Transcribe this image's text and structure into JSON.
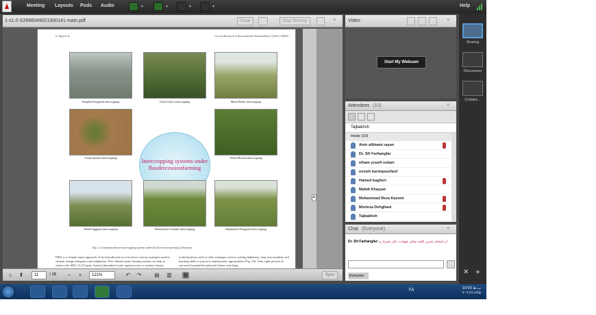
{
  "menubar": {
    "items": [
      "Meeting",
      "Layouts",
      "Pods",
      "Audio"
    ],
    "help": "Help"
  },
  "share": {
    "doc_title": "1-s1.0-S2666049021000141-main.pdf",
    "buttons": [
      "Draw",
      "Stop Sharing"
    ]
  },
  "pdf": {
    "header_left": "S. Sajjd et al.",
    "header_right": "Current Research in Environmental Sustainability 3 (2021) 100043",
    "figure_center": "Intercropping systems under floodrecessionfarming",
    "captions": [
      "Pumpkin Fenugreek intercropping",
      "Onion-Garlic intercropping",
      "Marsh Barley intercropping",
      "Turnip Spinach intercropping",
      "Wheat Mustard intercropping",
      "Fennel-Eggplant intercropping",
      "Watermelon Coriander intercropping",
      "Muskmelon Fenugreek intercropping"
    ],
    "fig_caption": "Fig. 2. Community-based intercropping systems under flood recession farming of Sanowan.",
    "para_left": "FRFs is a climate-smart approach of food production as it involves various strategies used in climate change mitigation and adaptation. This climate-smart farming system can help to achieve the SDG-13 (Climate Action) (Intended to take urgent action to combat climate change and its impacts.",
    "para_right": "foodrelaxation, and (c) other strategies such as waiting helplessly, long term mobility and learning skills to join new employment opportunities (Fig. 10). Only eight percent of surveyed households indicated labour switching."
  },
  "docbar": {
    "page": "11",
    "total": "/ 16",
    "zoom": "121%",
    "sync": "Sync"
  },
  "video": {
    "title": "Video",
    "webcam_button": "Start My Webcam"
  },
  "attendees": {
    "title": "Attendees",
    "count": "(10)",
    "presenter": "Tajbakhsh",
    "hosts_label": "Hosts (10)",
    "list": [
      "Amir afkhami rayan",
      "Dr. SH Farhangfar",
      "elham yusefi nobari",
      "ensieh karimpourfard",
      "Hamed bagheri",
      "Mahdi Khayyat",
      "Mohammad Reza Kazemi",
      "Morteza Dehghani",
      "Tajbakhsh"
    ]
  },
  "chat": {
    "title": "Chat",
    "scope": "(Everyone)",
    "sender": "Dr. SH Farhangfar:",
    "message": "از امتحان تحریر کلمه ستان شهادت علی شیراز و",
    "tab": "Everyone"
  },
  "layouts": [
    {
      "label": "Sharing"
    },
    {
      "label": "Discussion"
    },
    {
      "label": "Collabo..."
    }
  ],
  "taskbar": {
    "lang": "FA",
    "time": "10:03 ب.ظ",
    "date": "۲۰۲۱/۱۱/۲۵"
  }
}
